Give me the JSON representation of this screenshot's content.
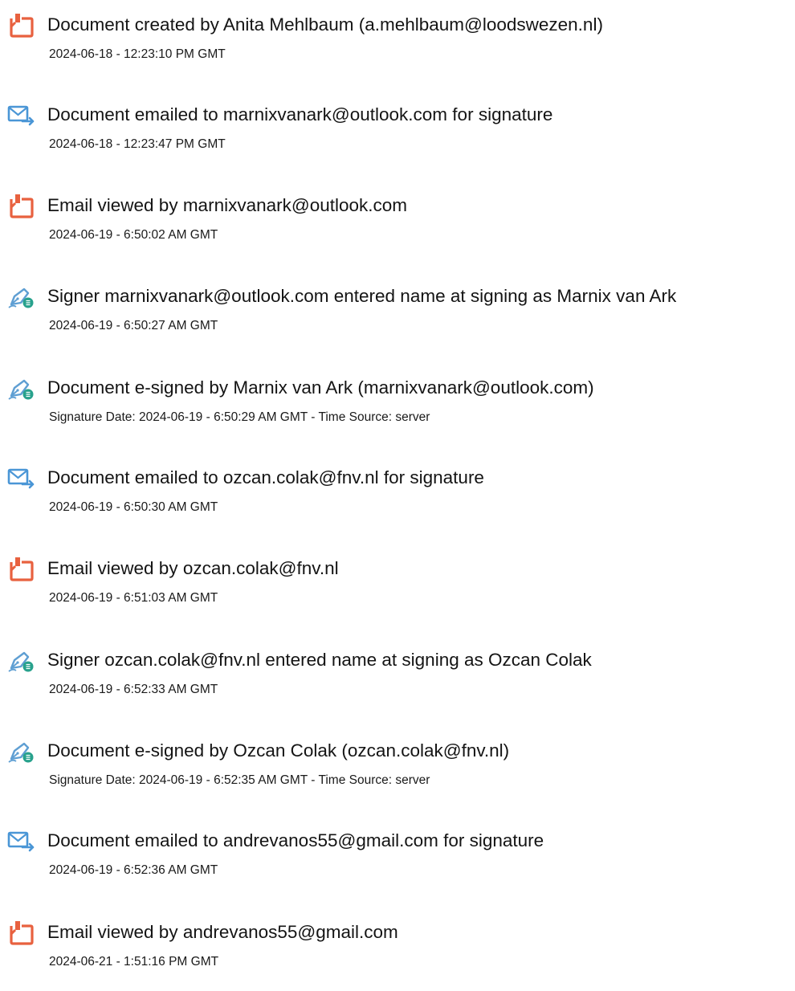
{
  "events": [
    {
      "icon": "document-created-icon",
      "title": "Document created by Anita Mehlbaum (a.mehlbaum@loodswezen.nl)",
      "timestamp": "2024-06-18 - 12:23:10 PM GMT"
    },
    {
      "icon": "email-sent-icon",
      "title": "Document emailed to marnixvanark@outlook.com for signature",
      "timestamp": "2024-06-18 - 12:23:47 PM GMT"
    },
    {
      "icon": "email-viewed-icon",
      "title": "Email viewed by marnixvanark@outlook.com",
      "timestamp": "2024-06-19 - 6:50:02 AM GMT"
    },
    {
      "icon": "signature-pen-icon",
      "title": "Signer marnixvanark@outlook.com entered name at signing as Marnix van Ark",
      "timestamp": "2024-06-19 - 6:50:27 AM GMT"
    },
    {
      "icon": "signature-pen-icon",
      "title": "Document e-signed by Marnix van Ark (marnixvanark@outlook.com)",
      "timestamp": "Signature Date: 2024-06-19 - 6:50:29 AM GMT - Time Source: server"
    },
    {
      "icon": "email-sent-icon",
      "title": "Document emailed to ozcan.colak@fnv.nl for signature",
      "timestamp": "2024-06-19 - 6:50:30 AM GMT"
    },
    {
      "icon": "email-viewed-icon",
      "title": "Email viewed by ozcan.colak@fnv.nl",
      "timestamp": "2024-06-19 - 6:51:03 AM GMT"
    },
    {
      "icon": "signature-pen-icon",
      "title": "Signer ozcan.colak@fnv.nl entered name at signing as Ozcan Colak",
      "timestamp": "2024-06-19 - 6:52:33 AM GMT"
    },
    {
      "icon": "signature-pen-icon",
      "title": "Document e-signed by Ozcan Colak (ozcan.colak@fnv.nl)",
      "timestamp": "Signature Date: 2024-06-19 - 6:52:35 AM GMT - Time Source: server"
    },
    {
      "icon": "email-sent-icon",
      "title": "Document emailed to andrevanos55@gmail.com for signature",
      "timestamp": "2024-06-19 - 6:52:36 AM GMT"
    },
    {
      "icon": "email-viewed-icon",
      "title": "Email viewed by andrevanos55@gmail.com",
      "timestamp": "2024-06-21 - 1:51:16 PM GMT"
    }
  ],
  "colors": {
    "document_icon": "#e8613f",
    "email_icon": "#4a96d6",
    "pen_icon": "#5f9fd3",
    "pen_badge": "#27a18c",
    "text": "#141414"
  }
}
